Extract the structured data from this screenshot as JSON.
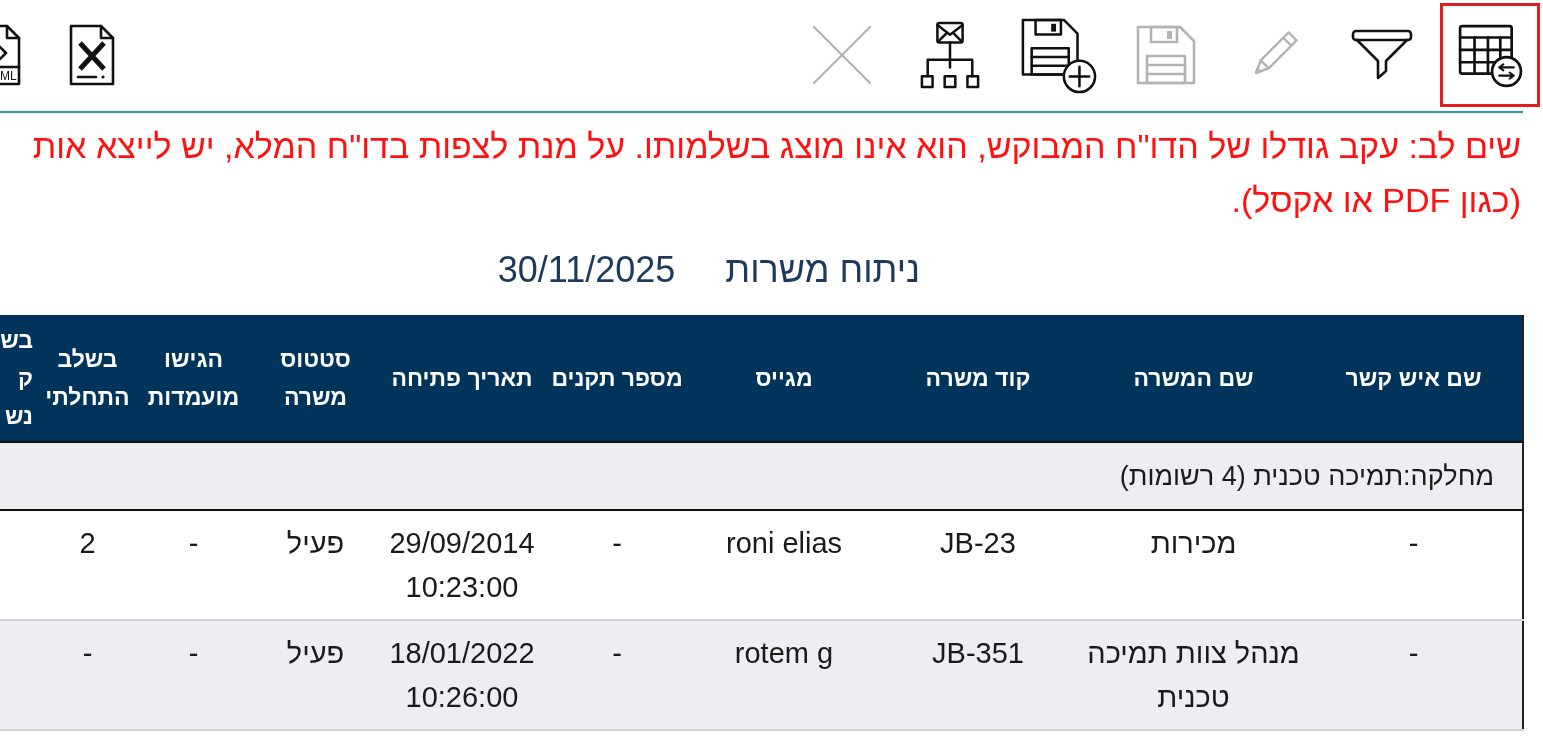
{
  "toolbar": {
    "actions": [
      {
        "kind": "table-swap",
        "selected": true,
        "disabled": false
      },
      {
        "kind": "filter",
        "selected": false,
        "disabled": false
      },
      {
        "kind": "edit",
        "selected": false,
        "disabled": true
      },
      {
        "kind": "save",
        "selected": false,
        "disabled": true
      },
      {
        "kind": "save-new",
        "selected": false,
        "disabled": false
      },
      {
        "kind": "distribute",
        "selected": false,
        "disabled": false
      },
      {
        "kind": "close",
        "selected": false,
        "disabled": true
      }
    ],
    "exports": [
      {
        "kind": "excel"
      },
      {
        "kind": "html",
        "label": "ML"
      }
    ]
  },
  "warning": {
    "lines": [
      "שים לב: עקב גודלו של הדו\"ח המבוקש, הוא אינו מוצג בשלמותו. על מנת לצפות בדו\"ח המלא, יש לייצא אות",
      "(כגון PDF או אקסל)."
    ]
  },
  "report": {
    "title": "ניתוח משרות",
    "date": "30/11/2025"
  },
  "table": {
    "columns": [
      {
        "label": "שם איש קשר"
      },
      {
        "label": "שם המשרה"
      },
      {
        "label": "קוד משרה"
      },
      {
        "label": "מגייס"
      },
      {
        "label": "מספר תקנים"
      },
      {
        "label": "תאריך פתיחה"
      },
      {
        "label": "סטטוס משרה"
      },
      {
        "label": "הגישו מועמדות"
      },
      {
        "label": "בשלב התחלתי"
      },
      {
        "label": "בש ק נש"
      }
    ],
    "groups": [
      {
        "label": "מחלקה:תמיכה טכנית (4 רשומות)",
        "rows": [
          {
            "cells": [
              "-",
              "מכירות",
              "JB-23",
              "roni elias",
              "-",
              "29/09/2014 10:23:00",
              "פעיל",
              "-",
              "2"
            ]
          },
          {
            "cells": [
              "-",
              "מנהל צוות תמיכה טכנית",
              "JB-351",
              "rotem g",
              "-",
              "18/01/2022 10:26:00",
              "פעיל",
              "-",
              "-"
            ]
          }
        ]
      }
    ]
  }
}
